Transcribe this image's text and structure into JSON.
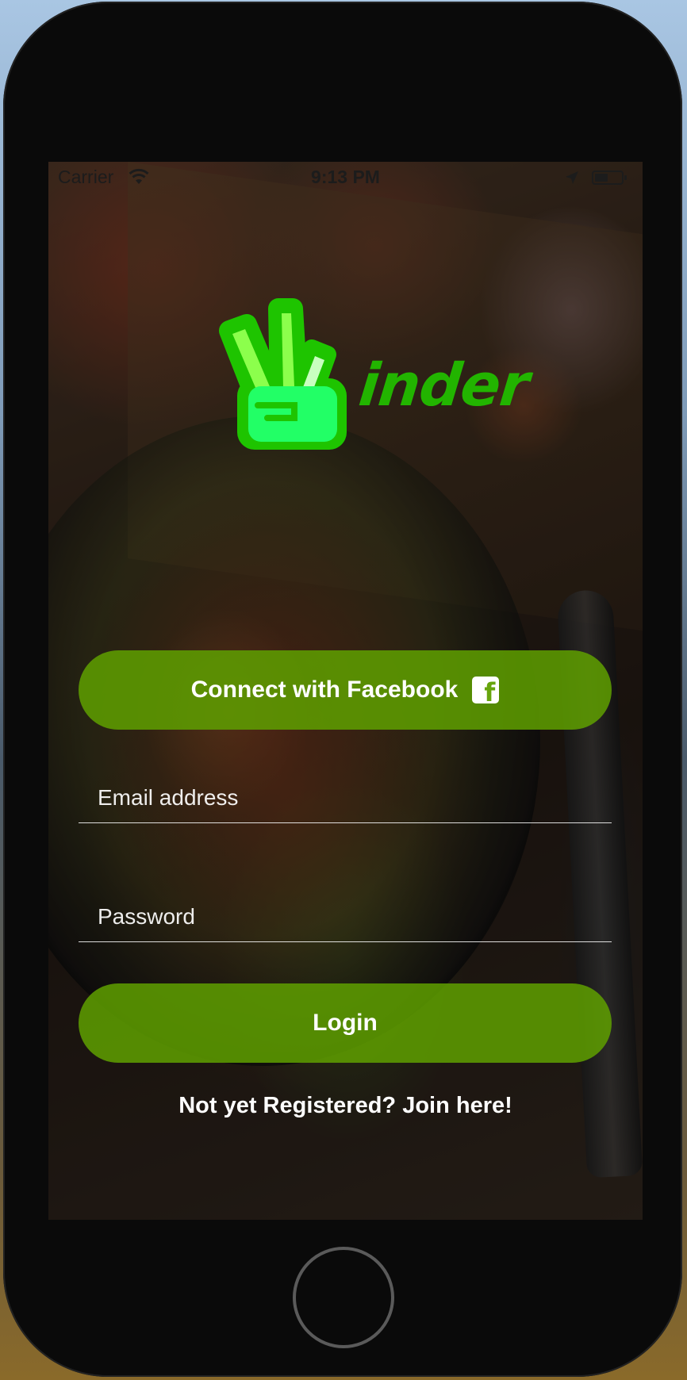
{
  "status_bar": {
    "carrier": "Carrier",
    "time": "9:13 PM",
    "battery_level": 0.5
  },
  "logo": {
    "wordmark": "inder",
    "icon": "peace-hand-icon",
    "color": "#22b400"
  },
  "facebook_button": {
    "label": "Connect with Facebook",
    "icon": "facebook-icon",
    "icon_glyph": "f"
  },
  "email_field": {
    "placeholder": "Email address",
    "value": ""
  },
  "password_field": {
    "placeholder": "Password",
    "value": ""
  },
  "login_button": {
    "label": "Login"
  },
  "register_link": {
    "label": "Not yet Registered? Join here!"
  },
  "colors": {
    "accent": "#5fa000",
    "text": "#ffffff",
    "frame": "#0a0a0a"
  }
}
